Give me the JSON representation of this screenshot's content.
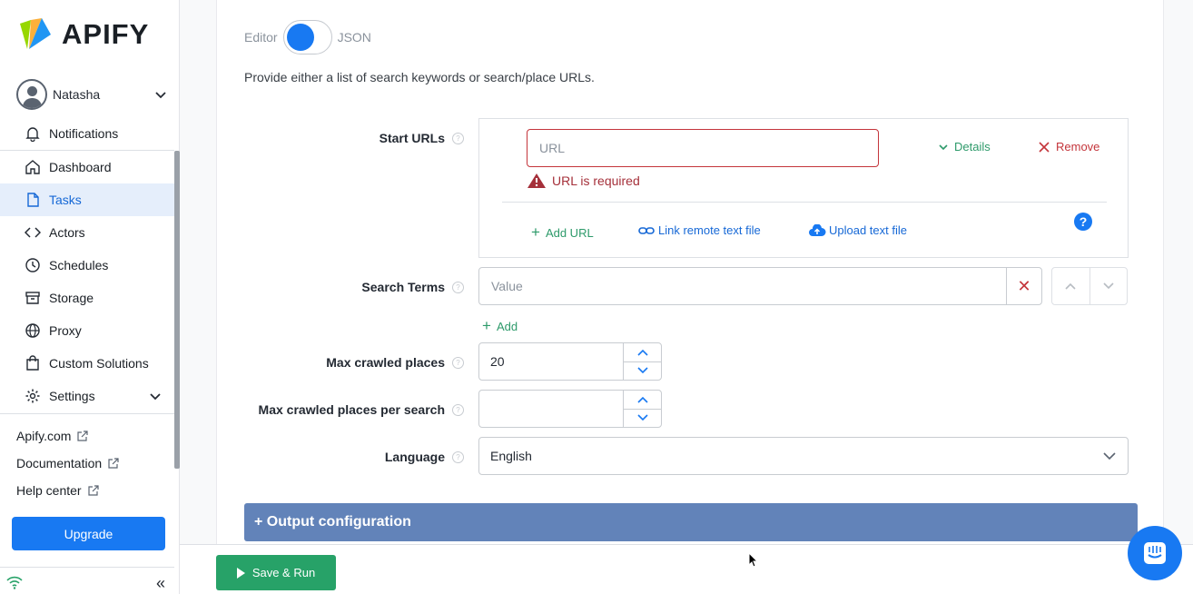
{
  "brand": {
    "name": "APIFY"
  },
  "user": {
    "name": "Natasha"
  },
  "nav": {
    "notifications": "Notifications",
    "dashboard": "Dashboard",
    "tasks": "Tasks",
    "actors": "Actors",
    "schedules": "Schedules",
    "storage": "Storage",
    "proxy": "Proxy",
    "custom_solutions": "Custom Solutions",
    "settings": "Settings"
  },
  "links": {
    "apify_com": "Apify.com",
    "documentation": "Documentation",
    "help_center": "Help center"
  },
  "upgrade_label": "Upgrade",
  "collapse_glyph": "«",
  "editor": {
    "left": "Editor",
    "right": "JSON"
  },
  "description": "Provide either a list of search keywords or search/place URLs.",
  "start_urls": {
    "label": "Start URLs",
    "placeholder": "URL",
    "details": "Details",
    "remove": "Remove",
    "error": "URL is required",
    "add_url": "Add URL",
    "link_remote": "Link remote text file",
    "upload": "Upload text file",
    "help_glyph": "?"
  },
  "search_terms": {
    "label": "Search Terms",
    "placeholder": "Value",
    "add": "Add",
    "clear_glyph": "✕"
  },
  "max_places": {
    "label": "Max crawled places",
    "value": "20"
  },
  "max_places_per_search": {
    "label": "Max crawled places per search",
    "value": ""
  },
  "language": {
    "label": "Language",
    "value": "English"
  },
  "output_config": "+ Output configuration",
  "save_run": "Save & Run",
  "help_dot_glyph": "?",
  "colors": {
    "accent": "#1879f2",
    "success": "#27a268",
    "error": "#c4353b",
    "section": "#6283b9"
  }
}
